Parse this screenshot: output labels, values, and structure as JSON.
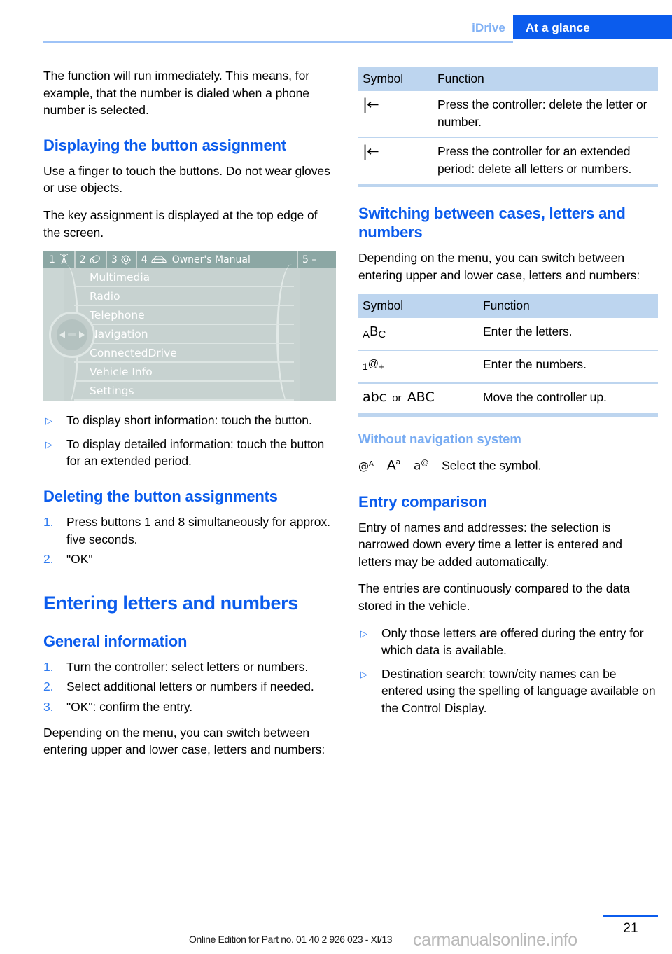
{
  "header": {
    "chapter": "iDrive",
    "section": "At a glance"
  },
  "left_column": {
    "intro_paragraph": "The function will run immediately. This means, for example, that the number is dialed when a phone number is selected.",
    "displaying_heading": "Displaying the button assignment",
    "displaying_para1": "Use a finger to touch the buttons. Do not wear gloves or use objects.",
    "displaying_para2": "The key assignment is displayed at the top edge of the screen.",
    "idrive_screen": {
      "toolbar": [
        {
          "number": "1",
          "icon": "radio-tower-icon"
        },
        {
          "number": "2",
          "icon": "phone-handset-icon"
        },
        {
          "number": "3",
          "icon": "gear-icon"
        },
        {
          "number": "4",
          "icon": "car-icon"
        }
      ],
      "title": "Owner's Manual",
      "right_label": "5 –",
      "menu_items": [
        "Multimedia",
        "Radio",
        "Telephone",
        "Navigation",
        "ConnectedDrive",
        "Vehicle Info",
        "Settings"
      ]
    },
    "touch_bullets": [
      "To display short information: touch the button.",
      "To display detailed information: touch the button for an extended period."
    ],
    "deleting_heading": "Deleting the button assignments",
    "deleting_steps": [
      {
        "num": "1.",
        "text": "Press buttons 1 and 8 simultaneously for approx. five seconds."
      },
      {
        "num": "2.",
        "text": "\"OK\""
      }
    ],
    "entering_title": "Entering letters and numbers",
    "general_heading": "General information",
    "general_steps": [
      {
        "num": "1.",
        "text": "Turn the controller: select letters or numbers."
      },
      {
        "num": "2.",
        "text": "Select additional letters or numbers if needed."
      },
      {
        "num": "3.",
        "text": "\"OK\": confirm the entry."
      }
    ],
    "closing_para": "Depending on the menu, you can switch between entering upper and lower case, letters and numbers:"
  },
  "right_column": {
    "delete_table": {
      "headers": [
        "Symbol",
        "Function"
      ],
      "rows": [
        {
          "symbol": "delete-one-icon",
          "symbol_glyph": "|←",
          "function": "Press the controller: delete the letter or number."
        },
        {
          "symbol": "delete-all-icon",
          "symbol_glyph": "|←",
          "function": "Press the controller for an extended period: delete all letters or numbers."
        }
      ]
    },
    "switching_heading": "Switching between cases, letters and numbers",
    "switching_para": "Depending on the menu, you can switch between entering upper and lower case, letters and numbers:",
    "switching_table": {
      "headers": [
        "Symbol",
        "Function"
      ],
      "rows": [
        {
          "symbol": "letters-abc-icon",
          "function": "Enter the letters."
        },
        {
          "symbol": "numbers-1at-icon",
          "function": "Enter the numbers."
        },
        {
          "symbol": "case-abc-icon",
          "function": "Move the controller up."
        }
      ]
    },
    "without_nav_heading": "Without navigation system",
    "without_nav_text": "Select the symbol.",
    "without_nav_symbols": [
      "@A",
      "Aa",
      "a@"
    ],
    "entry_comparison_heading": "Entry comparison",
    "entry_para1": "Entry of names and addresses: the selection is narrowed down every time a letter is entered and letters may be added automatically.",
    "entry_para2": "The entries are continuously compared to the data stored in the vehicle.",
    "entry_bullets": [
      "Only those letters are offered during the entry for which data is available.",
      "Destination search: town/city names can be entered using the spelling of language available on the Control Display."
    ]
  },
  "footer": {
    "online_edition": "Online Edition for Part no. 01 40 2 926 023 - XI/13",
    "watermark": "carmanualsonline.info",
    "page_number": "21"
  },
  "colors": {
    "brand_blue": "#0b5ced",
    "light_blue": "#7fb0f5",
    "table_header_blue": "#bdd5ef",
    "bullet_blue": "#2f7bf0",
    "idrive_bg": "#c7d2d0",
    "idrive_toolbar": "#8ca7a4"
  }
}
